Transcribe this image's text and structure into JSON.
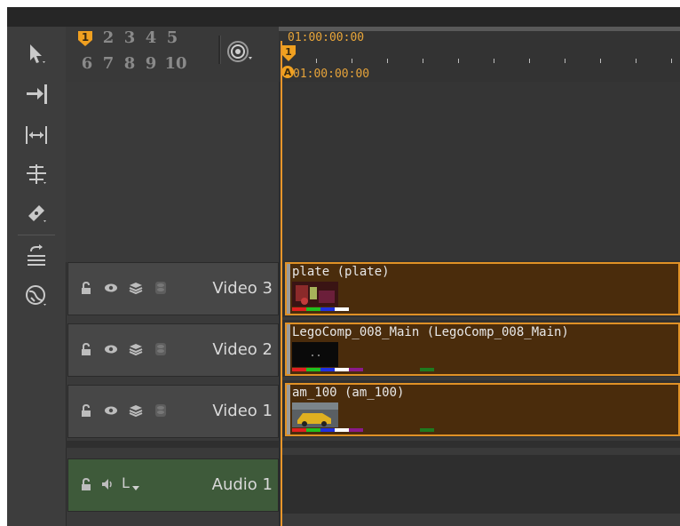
{
  "toolbar": {
    "tools": [
      {
        "name": "select-tool-icon"
      },
      {
        "name": "track-select-forward-icon"
      },
      {
        "name": "slip-fit-icon"
      },
      {
        "name": "roll-trim-icon"
      },
      {
        "name": "razor-tool-icon"
      },
      {
        "name": "slide-tool-icon"
      },
      {
        "name": "snap-globe-icon"
      }
    ]
  },
  "track_selector": {
    "numbers": [
      "1",
      "2",
      "3",
      "4",
      "5",
      "6",
      "7",
      "8",
      "9",
      "10"
    ],
    "selected": "1"
  },
  "ruler": {
    "timecode_top": "01:00:00:00",
    "timecode_a": "01:00:00:00",
    "marker_a_label": "A",
    "marker_in_label": "1"
  },
  "tracks": [
    {
      "name": "Video 3",
      "type": "video",
      "clip": "plate (plate)"
    },
    {
      "name": "Video 2",
      "type": "video",
      "clip": "LegoComp_008_Main (LegoComp_008_Main)"
    },
    {
      "name": "Video 1",
      "type": "video",
      "clip": "am_100 (am_100)"
    },
    {
      "name": "Audio 1",
      "type": "audio",
      "channel_label": "L"
    }
  ],
  "colors": {
    "accent": "#e9962a",
    "clip_bg": "#4a2c0c",
    "audio_header": "#3e5a3a"
  }
}
